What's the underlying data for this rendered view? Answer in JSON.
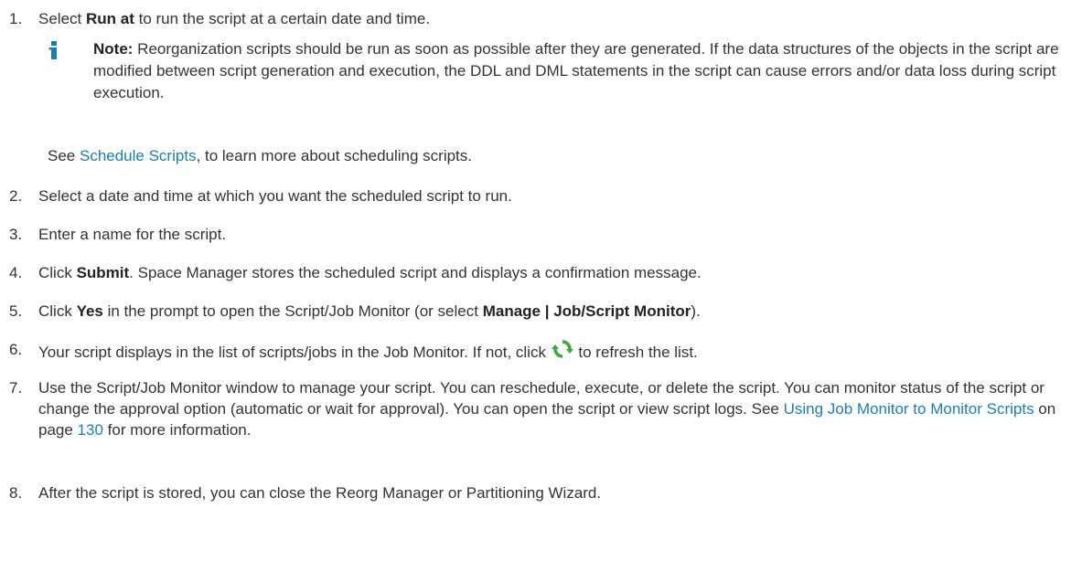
{
  "steps": [
    {
      "num": "1.",
      "pre": "Select ",
      "bold": "Run at",
      "post": " to run the script at a certain date and time."
    },
    {
      "num": "2.",
      "text": "Select a date and time at which you want the scheduled script to run."
    },
    {
      "num": "3.",
      "text": "Enter a name for the script."
    },
    {
      "num": "4.",
      "pre": "Click ",
      "bold": "Submit",
      "post": ". Space Manager stores the scheduled script and displays a confirmation message."
    },
    {
      "num": "5.",
      "pre": "Click ",
      "bold": "Yes",
      "mid": " in the prompt to open the Script/Job Monitor (or select ",
      "bold2": "Manage | Job/Script Monitor",
      "post": ")."
    },
    {
      "num": "6.",
      "pre": "Your script displays in the list of scripts/jobs in the Job Monitor. If not, click ",
      "post": " to refresh the list."
    },
    {
      "num": "7.",
      "pre": "Use the Script/Job Monitor window to manage your script. You can reschedule, execute, or delete the script. You can monitor status of the script or change the approval option (automatic or wait for approval). You can open the script or view script logs. See ",
      "link": "Using Job Monitor to Monitor Scripts",
      "mid": " on page ",
      "page_link": "130",
      "post": " for more information."
    },
    {
      "num": "8.",
      "text": "After the script is stored, you can close the Reorg Manager or Partitioning Wizard."
    }
  ],
  "note": {
    "icon": "info-icon",
    "label": "Note:",
    "text": " Reorganization scripts should be run as soon as possible after they are generated. If the data structures of the objects in the script are modified between script generation and execution, the DDL and DML statements in the script can cause errors and/or data loss during script execution."
  },
  "see": {
    "pre": "See ",
    "link": "Schedule Scripts",
    "post": ", to learn more about scheduling scripts."
  },
  "colors": {
    "text": "#333333",
    "link": "#1a7fb0",
    "note_icon": "#1a7fb0",
    "refresh_icon": "#3aa83a"
  }
}
